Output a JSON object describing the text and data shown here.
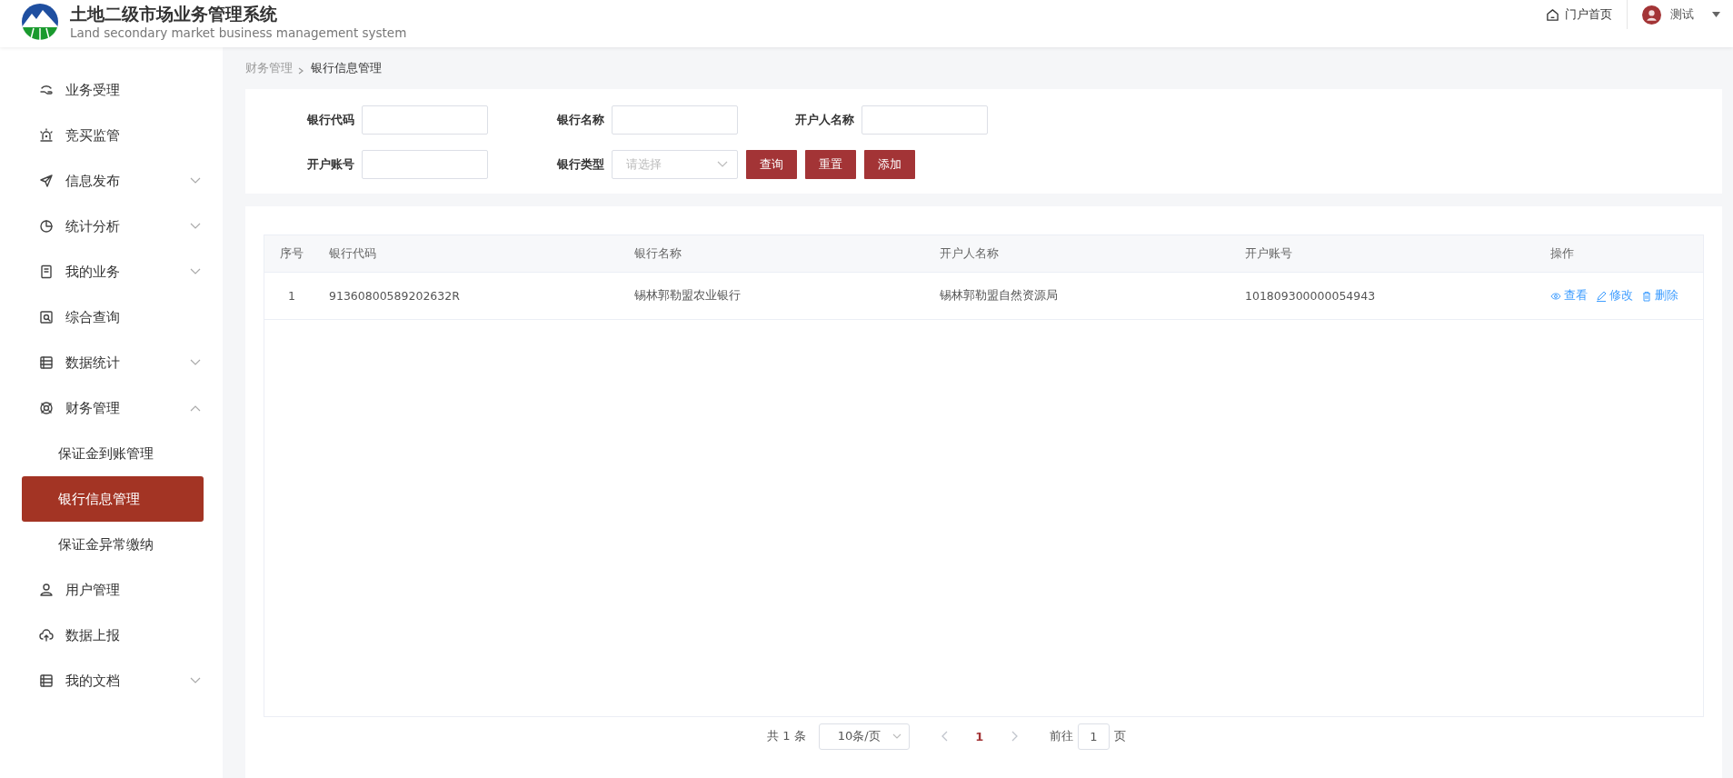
{
  "header": {
    "title": "土地二级市场业务管理系统",
    "subtitle": "Land secondary market business management system",
    "portal_link": "门户首页",
    "user_name": "测试"
  },
  "sidebar": {
    "items": [
      {
        "label": "业务受理"
      },
      {
        "label": "竞买监管"
      },
      {
        "label": "信息发布",
        "expanded": false
      },
      {
        "label": "统计分析",
        "expanded": false
      },
      {
        "label": "我的业务",
        "expanded": false
      },
      {
        "label": "综合查询"
      },
      {
        "label": "数据统计",
        "expanded": false
      },
      {
        "label": "财务管理",
        "expanded": true,
        "children": [
          {
            "label": "保证金到账管理",
            "selected": false
          },
          {
            "label": "银行信息管理",
            "selected": true
          },
          {
            "label": "保证金异常缴纳",
            "selected": false
          }
        ]
      },
      {
        "label": "用户管理"
      },
      {
        "label": "数据上报"
      },
      {
        "label": "我的文档",
        "expanded": false
      }
    ]
  },
  "breadcrumb": [
    "财务管理",
    "银行信息管理"
  ],
  "filters": {
    "fields": [
      {
        "label": "银行代码",
        "kind": "input"
      },
      {
        "label": "银行名称",
        "kind": "input"
      },
      {
        "label": "开户人名称",
        "kind": "input"
      },
      {
        "label": "开户账号",
        "kind": "input"
      },
      {
        "label": "银行类型",
        "kind": "select",
        "placeholder": "请选择"
      }
    ],
    "buttons": [
      "查询",
      "重置",
      "添加"
    ]
  },
  "table": {
    "columns": [
      "序号",
      "银行代码",
      "银行名称",
      "开户人名称",
      "开户账号",
      "操作"
    ],
    "rows": [
      {
        "cells": [
          "1",
          "91360800589202632R",
          "锡林郭勒盟农业银行",
          "锡林郭勒盟自然资源局",
          "101809300000054943"
        ],
        "actions": [
          "查看",
          "修改",
          "删除"
        ]
      }
    ]
  },
  "pagination": {
    "total": "共 1 条",
    "page_size": "10条/页",
    "prev": {
      "disabled": true
    },
    "pages": [
      {
        "label": "1",
        "selected": true
      }
    ],
    "next": {
      "disabled": true
    },
    "goto_label": "前往",
    "goto_value": "1",
    "goto_suffix": "页"
  }
}
